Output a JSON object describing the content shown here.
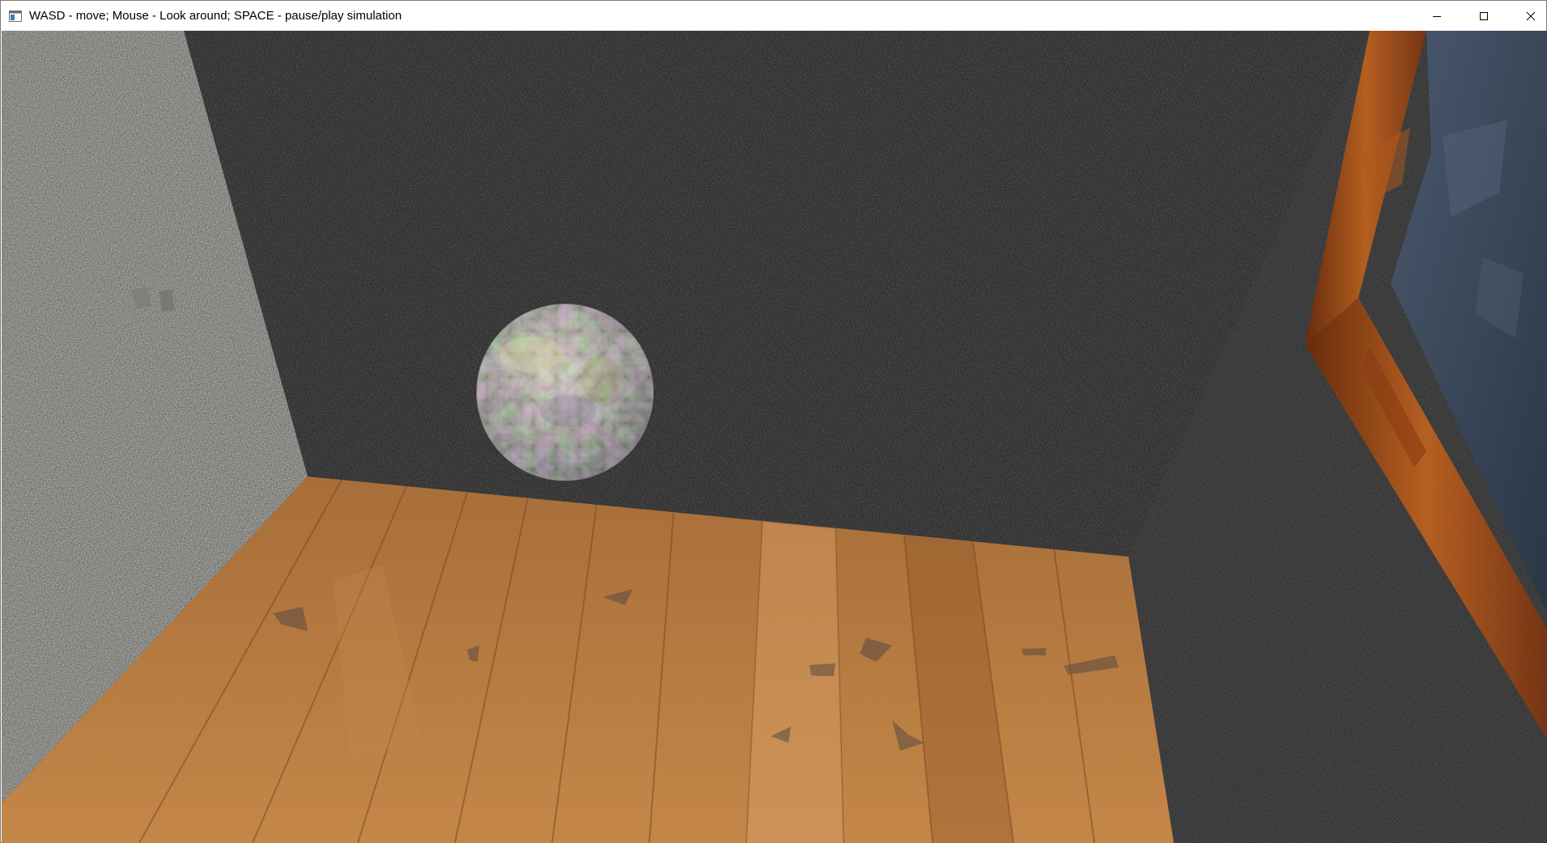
{
  "window": {
    "title": "WASD - move; Mouse - Look around; SPACE - pause/play simulation"
  },
  "caption_buttons": {
    "minimize_icon": "minimize-icon",
    "maximize_icon": "maximize-icon",
    "close_icon": "close-icon"
  },
  "scene": {
    "objects": [
      "left-wall",
      "back-wall",
      "right-wall",
      "wooden-floor",
      "marbled-sphere",
      "wooden-window-frame",
      "glass-pane"
    ],
    "colors": {
      "left_wall": "#b4b4b0",
      "back_wall": "#2c2c2c",
      "floor": "#b87a3c",
      "window_frame": "#a04a12",
      "glass": "#3a4a5c"
    }
  }
}
